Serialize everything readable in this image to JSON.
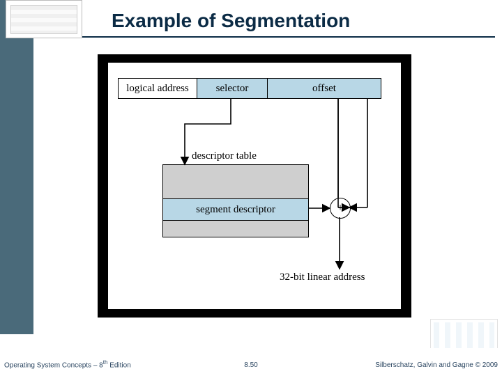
{
  "slide": {
    "title": "Example of Segmentation"
  },
  "diagram": {
    "logical_address_label": "logical address",
    "selector_label": "selector",
    "offset_label": "offset",
    "descriptor_table_label": "descriptor table",
    "segment_descriptor_label": "segment descriptor",
    "plus_symbol": "+",
    "linear_address_label": "32-bit linear address"
  },
  "footer": {
    "left_prefix": "Operating System Concepts – 8",
    "left_suffix": " Edition",
    "ordinal": "th",
    "page_number": "8.50",
    "right": "Silberschatz, Galvin and Gagne © 2009"
  }
}
